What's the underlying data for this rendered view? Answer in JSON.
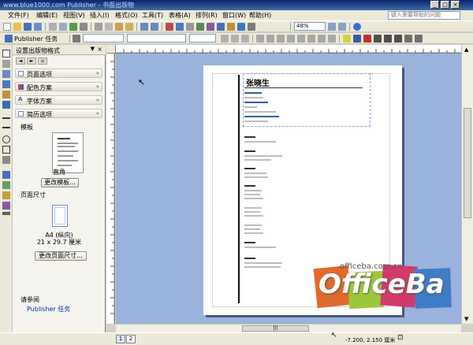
{
  "titlebar": {
    "title": "www.blue1000.com  Publisher - 书面出版物"
  },
  "menu": [
    "文件(F)",
    "编辑(E)",
    "视图(V)",
    "插入(I)",
    "格式(O)",
    "工具(T)",
    "表格(A)",
    "排列(R)",
    "窗口(W)",
    "帮助(H)"
  ],
  "help_placeholder": "键入需要帮助的问题",
  "toolbar": {
    "zoom": "48%",
    "publisher_tasks": "Publisher 任务"
  },
  "pane": {
    "title": "设置出版物格式",
    "sections": [
      {
        "label": "页面选项",
        "icon": "page-options-icon"
      },
      {
        "label": "配色方案",
        "icon": "color-scheme-icon"
      },
      {
        "label": "字体方案",
        "icon": "font-scheme-icon"
      },
      {
        "label": "简历选项",
        "icon": "resume-options-icon"
      }
    ],
    "template_label": "模板",
    "template_name": "直角",
    "change_template": "更改模板...",
    "page_size_label": "页面尺寸",
    "page_size_name": "A4 (纵向)",
    "page_size_dims": "21 x 29.7 厘米",
    "change_page_size": "更改页面尺寸...",
    "see_also": "请参阅",
    "see_also_link": "Publisher 任务"
  },
  "document": {
    "name": "张晓生"
  },
  "watermark": {
    "site": "officeba.com.cn",
    "word": "OfficeBa",
    "colors": [
      "#e06a2a",
      "#9bc83a",
      "#d23a6a",
      "#3f7cc8"
    ]
  },
  "status": {
    "pages": [
      "1",
      "2"
    ],
    "coords": "-7.200, 2.150 厘米"
  }
}
